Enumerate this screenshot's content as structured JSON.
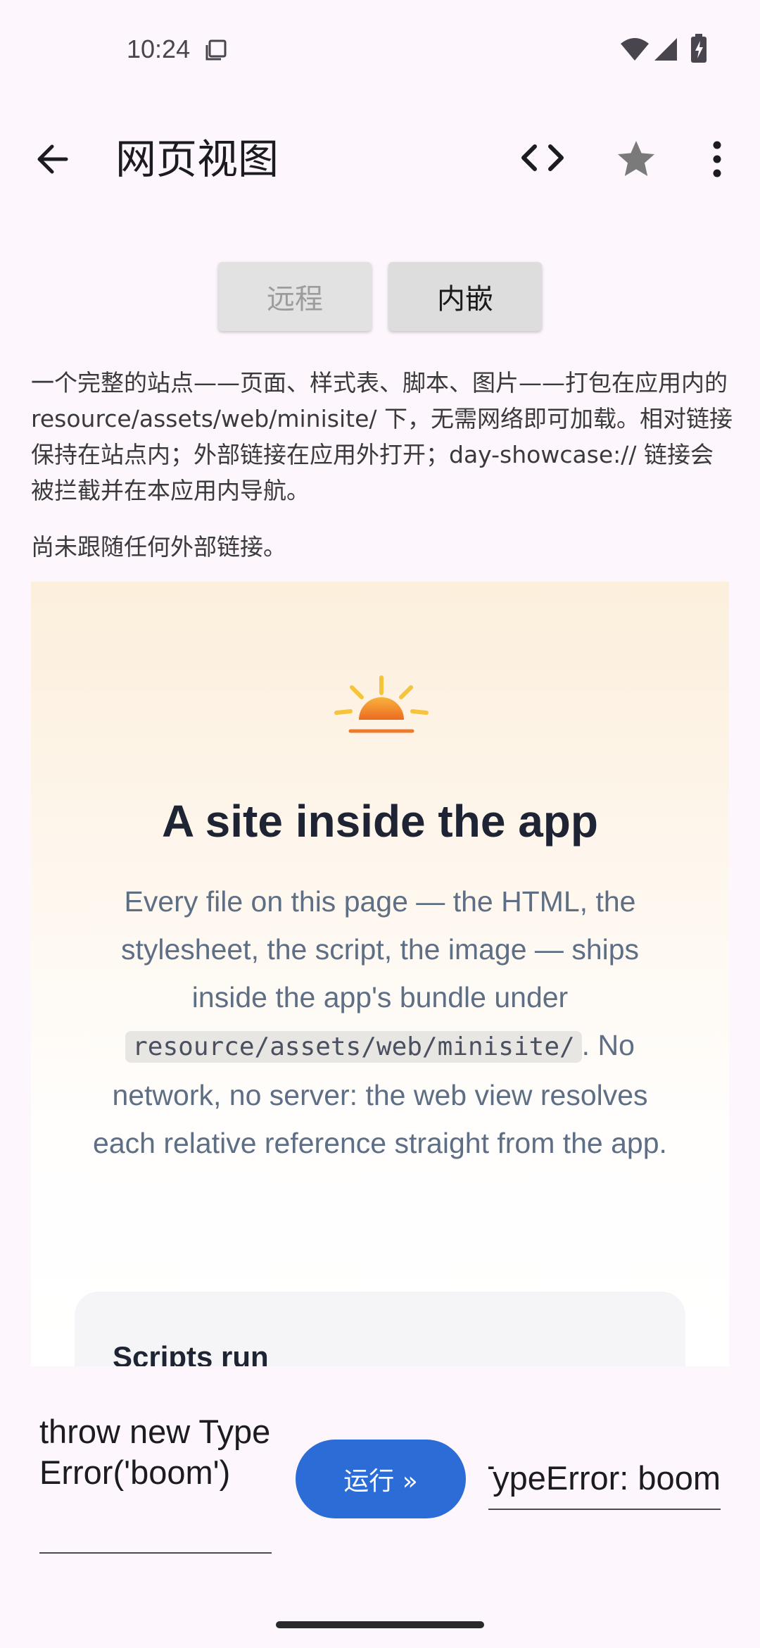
{
  "status_bar": {
    "time": "10:24",
    "copy_icon": "copy-icon",
    "wifi_icon": "wifi-icon",
    "cell_icon": "cellular-icon",
    "battery_icon": "battery-charging-icon"
  },
  "app_bar": {
    "title": "网页视图",
    "back_icon": "arrow-back-icon",
    "code_icon": "code-icon",
    "star_icon": "star-icon",
    "more_icon": "more-vert-icon"
  },
  "segments": {
    "remote": "远程",
    "inline": "内嵌",
    "selected": "内嵌"
  },
  "description": "一个完整的站点——页面、样式表、脚本、图片——打包在应用内的 resource/assets/web/minisite/ 下，无需网络即可加载。相对链接保持在站点内；外部链接在应用外打开；day-showcase:// 链接会被拦截并在本应用内导航。",
  "link_status": "尚未跟随任何外部链接。",
  "webview": {
    "title": "A site inside the app",
    "body_before": "Every file on this page — the HTML, the stylesheet, the script, the image — ships inside the app's bundle under ",
    "body_code": "resource/assets/web/minisite/",
    "body_after": ". No network, no server: the web view resolves each relative reference straight from the app.",
    "card_title": "Scripts run"
  },
  "controls": {
    "code_input_value": "throw new TypeError('boom')",
    "run_label": "运行 »",
    "result_value": "TypeError: boom"
  },
  "colors": {
    "background": "#FDF7FD",
    "accent": "#2C6CD6",
    "sun_yellow": "#F6C43A",
    "sun_orange": "#F07A2A"
  }
}
